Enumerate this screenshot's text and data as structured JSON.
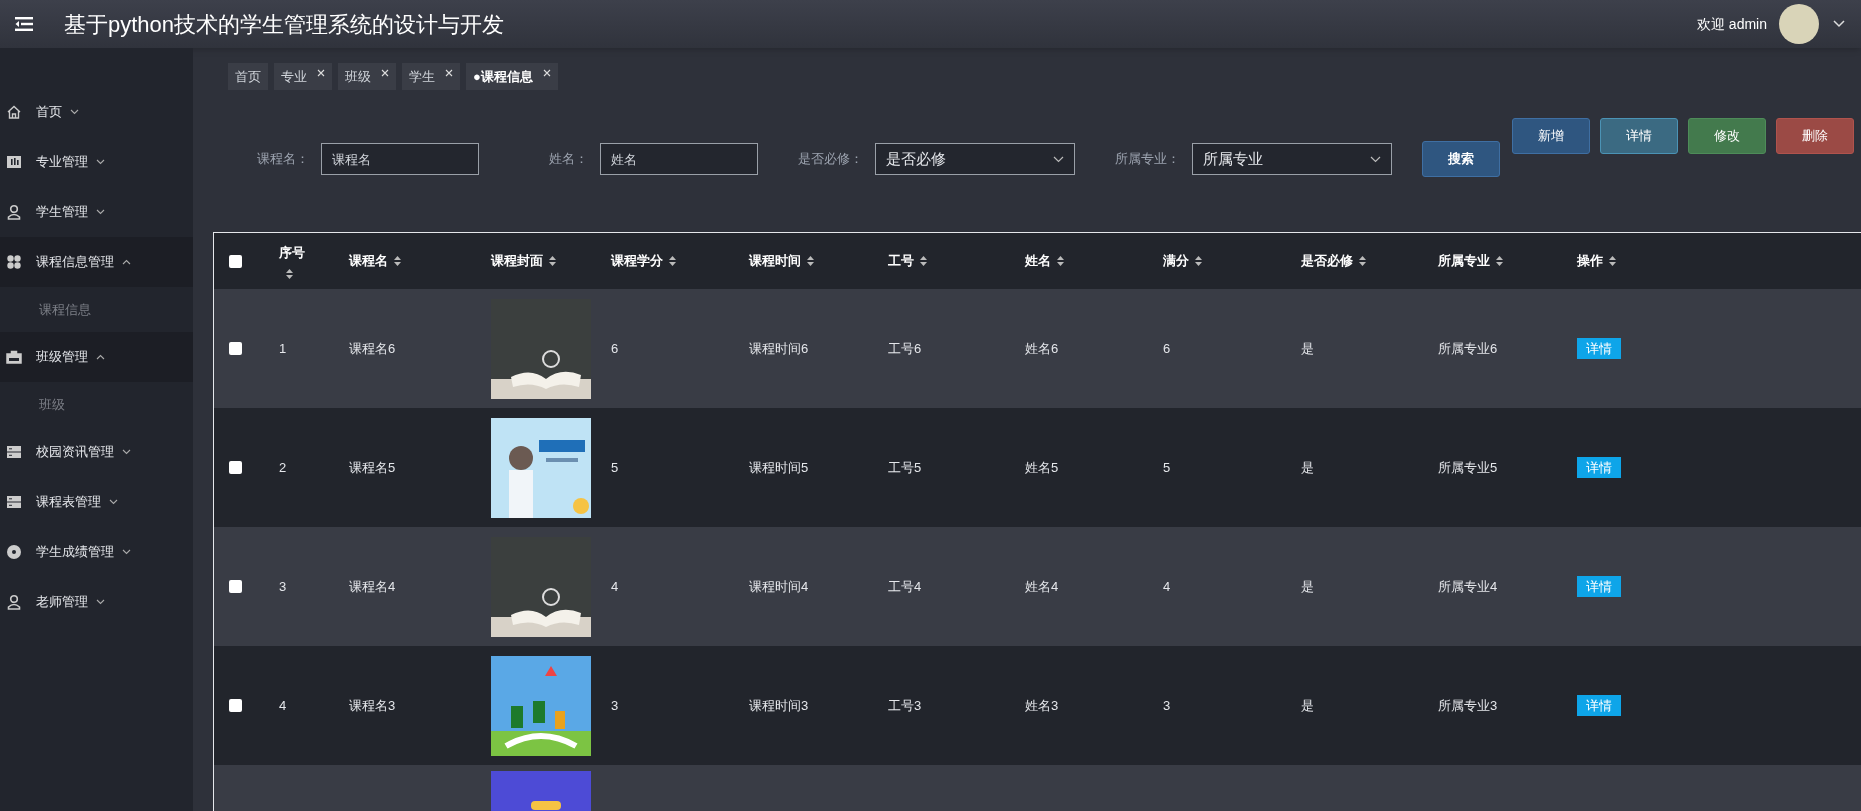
{
  "header": {
    "title": "基于python技术的学生管理系统的设计与开发",
    "welcome": "欢迎 admin"
  },
  "tabs": [
    {
      "label": "首页",
      "closable": false,
      "selected": false
    },
    {
      "label": "专业",
      "closable": true,
      "selected": false
    },
    {
      "label": "班级",
      "closable": true,
      "selected": false
    },
    {
      "label": "学生",
      "closable": true,
      "selected": false
    },
    {
      "label": "●课程信息",
      "closable": true,
      "selected": true
    }
  ],
  "sidebar": {
    "items": [
      {
        "label": "首页",
        "expanded": false
      },
      {
        "label": "专业管理",
        "expanded": false
      },
      {
        "label": "学生管理",
        "expanded": false
      },
      {
        "label": "课程信息管理",
        "expanded": true,
        "children": [
          {
            "label": "课程信息"
          }
        ]
      },
      {
        "label": "班级管理",
        "expanded": true,
        "children": [
          {
            "label": "班级"
          }
        ]
      },
      {
        "label": "校园资讯管理",
        "expanded": false
      },
      {
        "label": "课程表管理",
        "expanded": false
      },
      {
        "label": "学生成绩管理",
        "expanded": false
      },
      {
        "label": "老师管理",
        "expanded": false
      }
    ]
  },
  "filters": [
    {
      "kind": "input",
      "label": "课程名：",
      "placeholder": "课程名"
    },
    {
      "kind": "input",
      "label": "姓名：",
      "placeholder": "姓名"
    },
    {
      "kind": "select",
      "label": "是否必修：",
      "placeholder": "是否必修"
    },
    {
      "kind": "select",
      "label": "所属专业：",
      "placeholder": "所属专业"
    }
  ],
  "search_button": "搜索",
  "actions": [
    {
      "label": "新增",
      "kind": "add"
    },
    {
      "label": "详情",
      "kind": "detail"
    },
    {
      "label": "修改",
      "kind": "edit"
    },
    {
      "label": "删除",
      "kind": "delete"
    }
  ],
  "table": {
    "select_all_checked": false,
    "columns": [
      "序号",
      "课程名",
      "课程封面",
      "课程学分",
      "课程时间",
      "工号",
      "姓名",
      "满分",
      "是否必修",
      "所属专业",
      "操作"
    ],
    "rows": [
      {
        "kind": "full",
        "checked": false,
        "cells": [
          "1",
          "课程名6",
          "",
          "6",
          "课程时间6",
          "工号6",
          "姓名6",
          "6",
          "是",
          "所属专业6"
        ],
        "button": "详情"
      },
      {
        "kind": "full",
        "checked": false,
        "cells": [
          "2",
          "课程名5",
          "",
          "5",
          "课程时间5",
          "工号5",
          "姓名5",
          "5",
          "是",
          "所属专业5"
        ],
        "button": "详情"
      },
      {
        "kind": "full",
        "checked": false,
        "cells": [
          "3",
          "课程名4",
          "",
          "4",
          "课程时间4",
          "工号4",
          "姓名4",
          "4",
          "是",
          "所属专业4"
        ],
        "button": "详情"
      },
      {
        "kind": "full",
        "checked": false,
        "cells": [
          "4",
          "课程名3",
          "",
          "3",
          "课程时间3",
          "工号3",
          "姓名3",
          "3",
          "是",
          "所属专业3"
        ],
        "button": "详情"
      },
      {
        "kind": "partial"
      }
    ]
  }
}
